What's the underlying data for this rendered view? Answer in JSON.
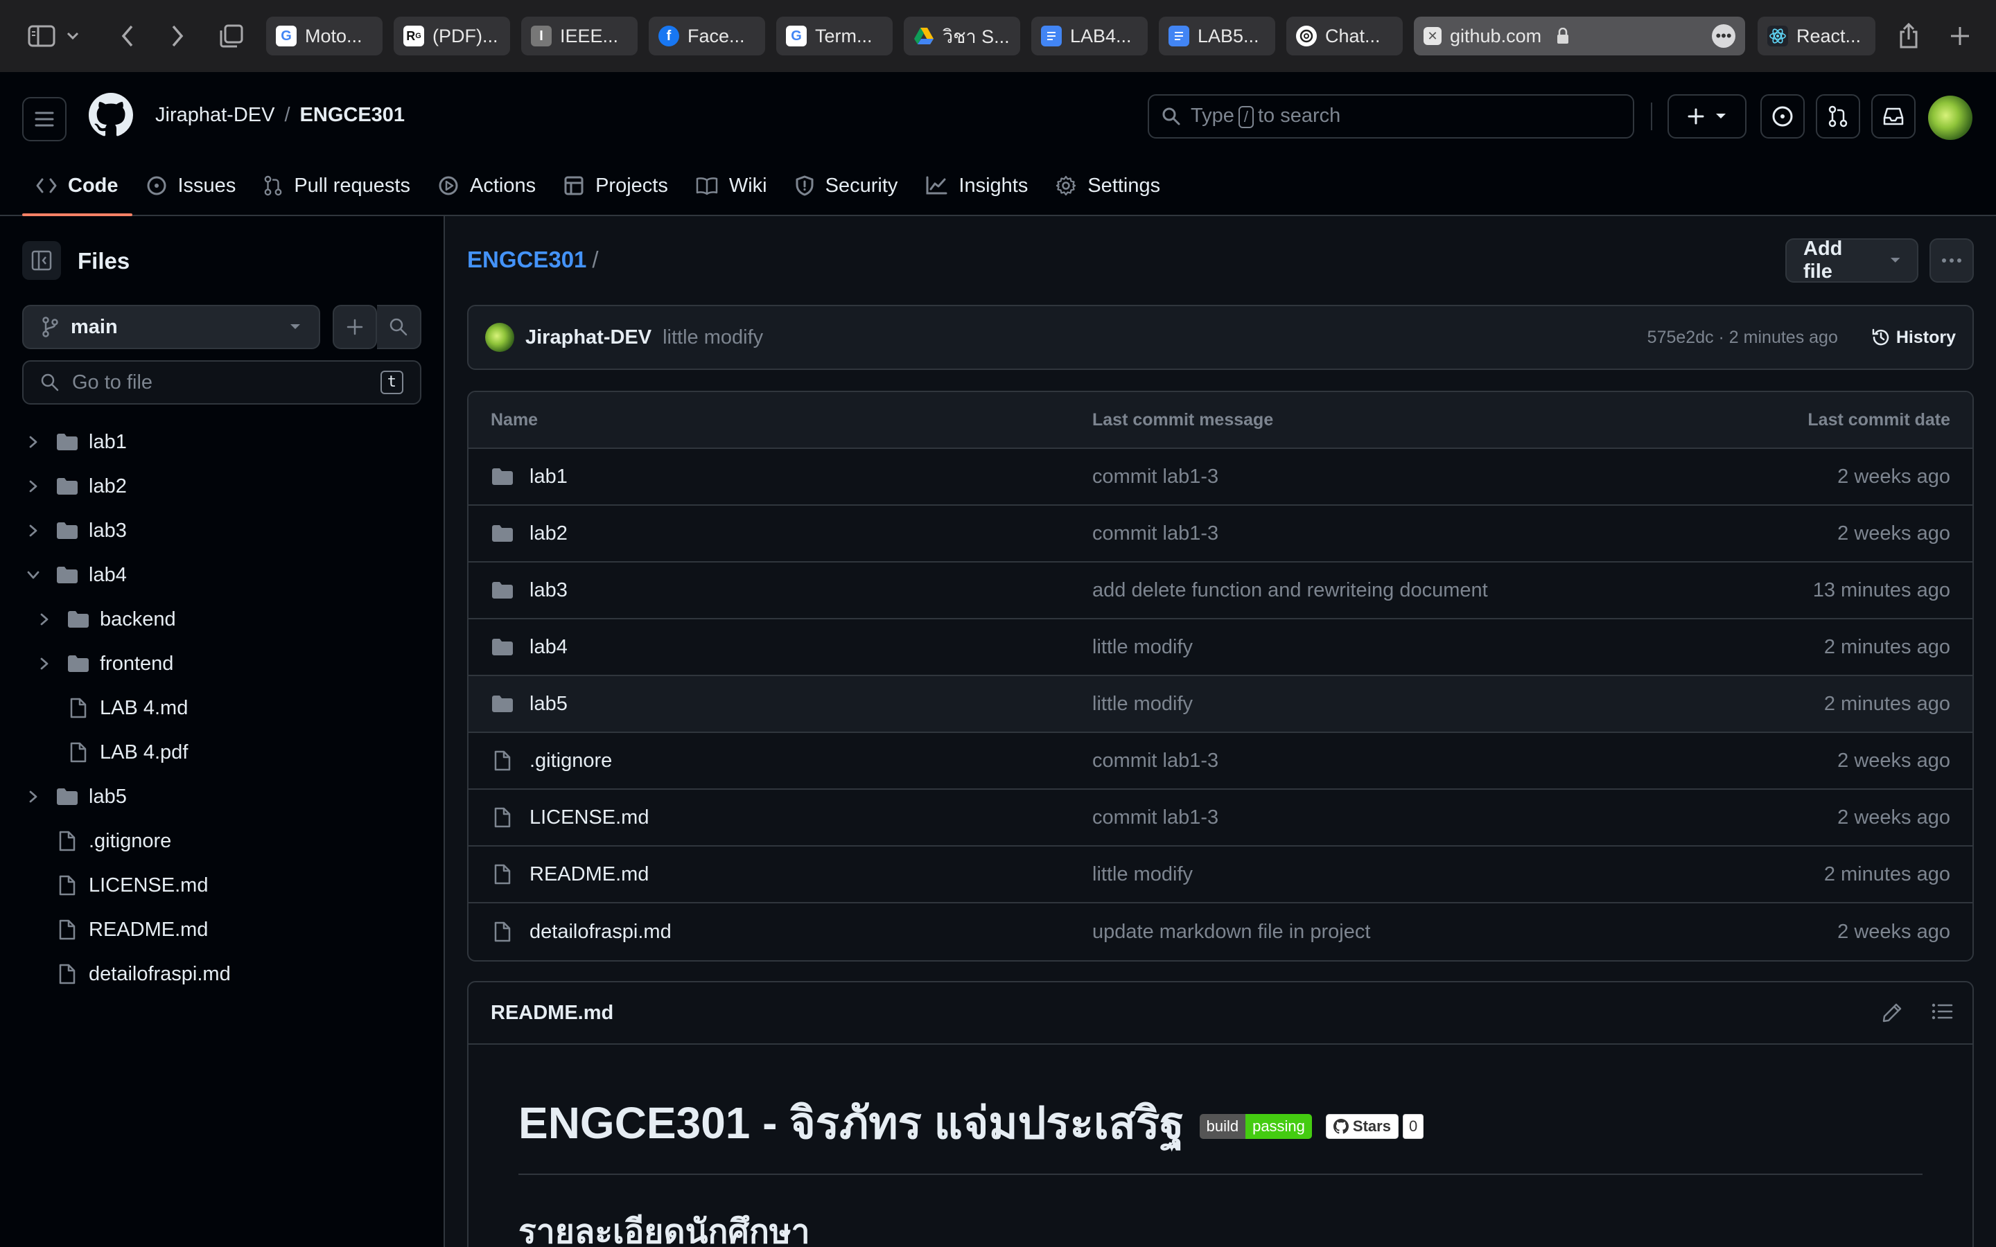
{
  "browser": {
    "tabs": [
      {
        "label": "Moto...",
        "icon": "google-icon"
      },
      {
        "label": "(PDF)...",
        "icon": "researchgate-icon"
      },
      {
        "label": "IEEE...",
        "icon": "ieee-icon"
      },
      {
        "label": "Face...",
        "icon": "facebook-icon"
      },
      {
        "label": "Term...",
        "icon": "google-icon"
      },
      {
        "label": "วิชา S...",
        "icon": "google-drive-icon"
      },
      {
        "label": "LAB4...",
        "icon": "google-docs-icon"
      },
      {
        "label": "LAB5...",
        "icon": "google-docs-icon"
      },
      {
        "label": "Chat...",
        "icon": "chatgpt-icon"
      },
      {
        "label": "github.com",
        "icon": "close-icon",
        "active": true
      },
      {
        "label": "React...",
        "icon": "react-icon"
      }
    ]
  },
  "header": {
    "owner": "Jiraphat-DEV",
    "separator": "/",
    "repo": "ENGCE301",
    "search_prefix": "Type",
    "search_key": "/",
    "search_suffix": "to search"
  },
  "repo_nav": [
    {
      "label": "Code",
      "icon": "code-icon",
      "active": true
    },
    {
      "label": "Issues",
      "icon": "issue-icon"
    },
    {
      "label": "Pull requests",
      "icon": "pull-request-icon"
    },
    {
      "label": "Actions",
      "icon": "play-icon"
    },
    {
      "label": "Projects",
      "icon": "table-icon"
    },
    {
      "label": "Wiki",
      "icon": "book-icon"
    },
    {
      "label": "Security",
      "icon": "shield-icon"
    },
    {
      "label": "Insights",
      "icon": "graph-icon"
    },
    {
      "label": "Settings",
      "icon": "gear-icon"
    }
  ],
  "sidebar": {
    "title": "Files",
    "branch": "main",
    "goto_placeholder": "Go to file",
    "goto_key": "t",
    "tree": [
      {
        "label": "lab1",
        "type": "folder",
        "depth": 0,
        "expanded": false
      },
      {
        "label": "lab2",
        "type": "folder",
        "depth": 0,
        "expanded": false
      },
      {
        "label": "lab3",
        "type": "folder",
        "depth": 0,
        "expanded": false
      },
      {
        "label": "lab4",
        "type": "folder",
        "depth": 0,
        "expanded": true
      },
      {
        "label": "backend",
        "type": "folder",
        "depth": 1,
        "expanded": false
      },
      {
        "label": "frontend",
        "type": "folder",
        "depth": 1,
        "expanded": false
      },
      {
        "label": "LAB 4.md",
        "type": "file",
        "depth": 1
      },
      {
        "label": "LAB 4.pdf",
        "type": "file",
        "depth": 1
      },
      {
        "label": "lab5",
        "type": "folder",
        "depth": 0,
        "expanded": false
      },
      {
        "label": ".gitignore",
        "type": "file",
        "depth": 0
      },
      {
        "label": "LICENSE.md",
        "type": "file",
        "depth": 0
      },
      {
        "label": "README.md",
        "type": "file",
        "depth": 0
      },
      {
        "label": "detailofraspi.md",
        "type": "file",
        "depth": 0
      }
    ]
  },
  "main": {
    "path_repo": "ENGCE301",
    "path_sep": "/",
    "add_file_label": "Add file",
    "commit": {
      "author": "Jiraphat-DEV",
      "message": "little modify",
      "meta": "575e2dc · 2 minutes ago",
      "history_label": "History"
    },
    "table": {
      "headers": {
        "name": "Name",
        "message": "Last commit message",
        "date": "Last commit date"
      },
      "rows": [
        {
          "name": "lab1",
          "type": "folder",
          "message": "commit lab1-3",
          "date": "2 weeks ago"
        },
        {
          "name": "lab2",
          "type": "folder",
          "message": "commit lab1-3",
          "date": "2 weeks ago"
        },
        {
          "name": "lab3",
          "type": "folder",
          "message": "add delete function and rewriteing document",
          "date": "13 minutes ago"
        },
        {
          "name": "lab4",
          "type": "folder",
          "message": "little modify",
          "date": "2 minutes ago"
        },
        {
          "name": "lab5",
          "type": "folder",
          "message": "little modify",
          "date": "2 minutes ago"
        },
        {
          "name": ".gitignore",
          "type": "file",
          "message": "commit lab1-3",
          "date": "2 weeks ago"
        },
        {
          "name": "LICENSE.md",
          "type": "file",
          "message": "commit lab1-3",
          "date": "2 weeks ago"
        },
        {
          "name": "README.md",
          "type": "file",
          "message": "little modify",
          "date": "2 minutes ago"
        },
        {
          "name": "detailofraspi.md",
          "type": "file",
          "message": "update markdown file in project",
          "date": "2 weeks ago"
        }
      ]
    },
    "readme": {
      "filename": "README.md",
      "h1": "ENGCE301 - จิรภัทร แจ่มประเสริฐ",
      "badge_build_left": "build",
      "badge_build_right": "passing",
      "badge_stars_label": "Stars",
      "badge_stars_count": "0",
      "h2": "รายละเอียดนักศึกษา"
    }
  },
  "colors": {
    "accent_link": "#4493f8",
    "active_tab_underline": "#f78166",
    "badge_passing": "#44cc11"
  }
}
